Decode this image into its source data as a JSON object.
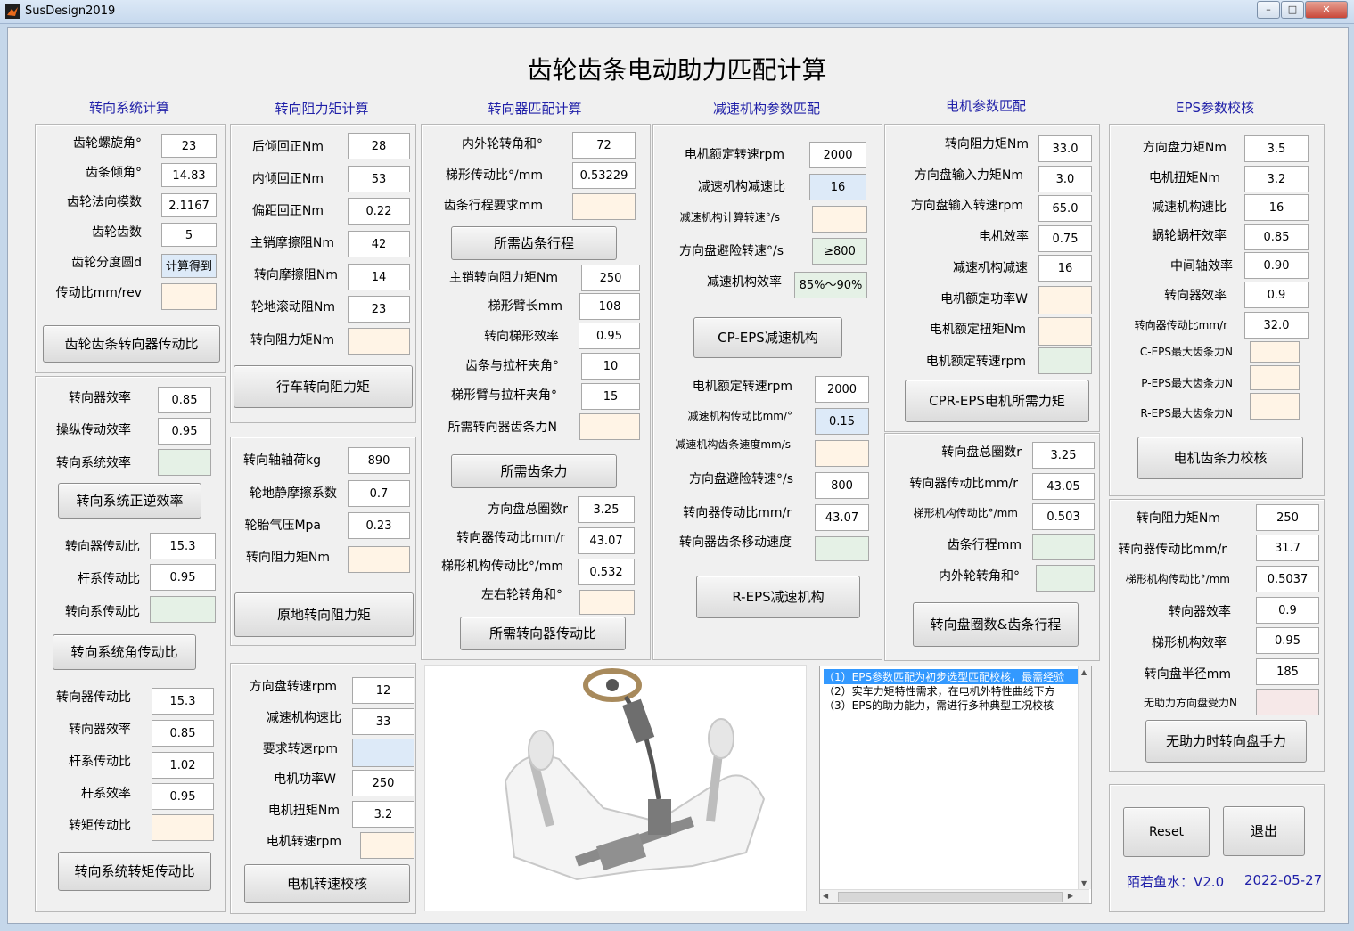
{
  "window": {
    "title": "SusDesign2019"
  },
  "main_title": "齿轮齿条电动助力匹配计算",
  "sections": {
    "s1": "转向系统计算",
    "s2": "转向阻力矩计算",
    "s3": "转向器匹配计算",
    "s4": "减速机构参数匹配",
    "s5": "电机参数匹配",
    "s6": "EPS参数校核"
  },
  "col1": {
    "p1": {
      "rows": [
        {
          "label": "齿轮螺旋角°",
          "value": "23"
        },
        {
          "label": "齿条倾角°",
          "value": "14.83"
        },
        {
          "label": "齿轮法向模数",
          "value": "2.1167"
        },
        {
          "label": "齿轮齿数",
          "value": "5"
        },
        {
          "label": "齿轮分度圆d",
          "value": "计算得到"
        },
        {
          "label": "传动比mm/rev",
          "value": ""
        }
      ],
      "button": "齿轮齿条转向器传动比"
    },
    "p2": {
      "rows": [
        {
          "label": "转向器效率",
          "value": "0.85"
        },
        {
          "label": "操纵传动效率",
          "value": "0.95"
        },
        {
          "label": "转向系统效率",
          "value": ""
        }
      ],
      "button": "转向系统正逆效率",
      "rows2": [
        {
          "label": "转向器传动比",
          "value": "15.3"
        },
        {
          "label": "杆系传动比",
          "value": "0.95"
        },
        {
          "label": "转向系传动比",
          "value": ""
        }
      ],
      "button2": "转向系统角传动比",
      "rows3": [
        {
          "label": "转向器传动比",
          "value": "15.3"
        },
        {
          "label": "转向器效率",
          "value": "0.85"
        },
        {
          "label": "杆系传动比",
          "value": "1.02"
        },
        {
          "label": "杆系效率",
          "value": "0.95"
        },
        {
          "label": "转矩传动比",
          "value": ""
        }
      ],
      "button3": "转向系统转矩传动比"
    }
  },
  "col2": {
    "p1": {
      "rows": [
        {
          "label": "后倾回正Nm",
          "value": "28"
        },
        {
          "label": "内倾回正Nm",
          "value": "53"
        },
        {
          "label": "偏距回正Nm",
          "value": "0.22"
        },
        {
          "label": "主销摩擦阻Nm",
          "value": "42"
        },
        {
          "label": "转向摩擦阻Nm",
          "value": "14"
        },
        {
          "label": "轮地滚动阻Nm",
          "value": "23"
        },
        {
          "label": "转向阻力矩Nm",
          "value": ""
        }
      ],
      "button": "行车转向阻力矩"
    },
    "p2": {
      "rows": [
        {
          "label": "转向轴轴荷kg",
          "value": "890"
        },
        {
          "label": "轮地静摩擦系数",
          "value": "0.7"
        },
        {
          "label": "轮胎气压Mpa",
          "value": "0.23"
        },
        {
          "label": "转向阻力矩Nm",
          "value": ""
        }
      ],
      "button": "原地转向阻力矩"
    },
    "p3": {
      "rows": [
        {
          "label": "方向盘转速rpm",
          "value": "12"
        },
        {
          "label": "减速机构速比",
          "value": "33"
        },
        {
          "label": "要求转速rpm",
          "value": ""
        },
        {
          "label": "电机功率W",
          "value": "250"
        },
        {
          "label": "电机扭矩Nm",
          "value": "3.2"
        },
        {
          "label": "电机转速rpm",
          "value": ""
        }
      ],
      "button": "电机转速校核"
    }
  },
  "col3": {
    "rows": [
      {
        "label": "内外轮转角和°",
        "value": "72"
      },
      {
        "label": "梯形传动比°/mm",
        "value": "0.53229"
      },
      {
        "label": "齿条行程要求mm",
        "value": ""
      }
    ],
    "button": "所需齿条行程",
    "rows2": [
      {
        "label": "主销转向阻力矩Nm",
        "value": "250"
      },
      {
        "label": "梯形臂长mm",
        "value": "108"
      },
      {
        "label": "转向梯形效率",
        "value": "0.95"
      },
      {
        "label": "齿条与拉杆夹角°",
        "value": "10"
      },
      {
        "label": "梯形臂与拉杆夹角°",
        "value": "15"
      },
      {
        "label": "所需转向器齿条力N",
        "value": ""
      }
    ],
    "button2": "所需齿条力",
    "rows3": [
      {
        "label": "方向盘总圈数r",
        "value": "3.25"
      },
      {
        "label": "转向器传动比mm/r",
        "value": "43.07"
      },
      {
        "label": "梯形机构传动比°/mm",
        "value": "0.532"
      },
      {
        "label": "左右轮转角和°",
        "value": ""
      }
    ],
    "button3": "所需转向器传动比"
  },
  "col4": {
    "rows": [
      {
        "label": "电机额定转速rpm",
        "value": "2000"
      },
      {
        "label": "减速机构减速比",
        "value": "16"
      },
      {
        "label": "减速机构计算转速°/s",
        "value": ""
      },
      {
        "label": "方向盘避险转速°/s",
        "value": "≥800"
      },
      {
        "label": "减速机构效率",
        "value": "85%～90%"
      }
    ],
    "button": "CP-EPS减速机构",
    "rows2": [
      {
        "label": "电机额定转速rpm",
        "value": "2000"
      },
      {
        "label": "减速机构传动比mm/°",
        "value": "0.15"
      },
      {
        "label": "减速机构齿条速度mm/s",
        "value": ""
      },
      {
        "label": "方向盘避险转速°/s",
        "value": "800"
      },
      {
        "label": "转向器传动比mm/r",
        "value": "43.07"
      },
      {
        "label": "转向器齿条移动速度mm/s",
        "value": ""
      }
    ],
    "button2": "R-EPS减速机构"
  },
  "col5": {
    "rows": [
      {
        "label": "转向阻力矩Nm",
        "value": "33.0"
      },
      {
        "label": "方向盘输入力矩Nm",
        "value": "3.0"
      },
      {
        "label": "方向盘输入转速rpm",
        "value": "65.0"
      },
      {
        "label": "电机效率",
        "value": "0.75"
      },
      {
        "label": "减速机构减速",
        "value": "16"
      },
      {
        "label": "电机额定功率W",
        "value": ""
      },
      {
        "label": "电机额定扭矩Nm",
        "value": ""
      },
      {
        "label": "电机额定转速rpm",
        "value": ""
      }
    ],
    "button": "CPR-EPS电机所需力矩",
    "rows2": [
      {
        "label": "转向盘总圈数r",
        "value": "3.25"
      },
      {
        "label": "转向器传动比mm/r",
        "value": "43.05"
      },
      {
        "label": "梯形机构传动比°/mm",
        "value": "0.503"
      },
      {
        "label": "齿条行程mm",
        "value": ""
      },
      {
        "label": "内外轮转角和°",
        "value": ""
      }
    ],
    "button2": "转向盘圈数&齿条行程"
  },
  "col6": {
    "rows": [
      {
        "label": "方向盘力矩Nm",
        "value": "3.5"
      },
      {
        "label": "电机扭矩Nm",
        "value": "3.2"
      },
      {
        "label": "减速机构速比",
        "value": "16"
      },
      {
        "label": "蜗轮蜗杆效率",
        "value": "0.85"
      },
      {
        "label": "中间轴效率",
        "value": "0.90"
      },
      {
        "label": "转向器效率",
        "value": "0.9"
      },
      {
        "label": "转向器传动比mm/r",
        "value": "32.0"
      },
      {
        "label": "C-EPS最大齿条力N",
        "value": ""
      },
      {
        "label": "P-EPS最大齿条力N",
        "value": ""
      },
      {
        "label": "R-EPS最大齿条力N",
        "value": ""
      }
    ],
    "button": "电机齿条力校核",
    "rows2": [
      {
        "label": "转向阻力矩Nm",
        "value": "250"
      },
      {
        "label": "转向器传动比mm/r",
        "value": "31.7"
      },
      {
        "label": "梯形机构传动比°/mm",
        "value": "0.5037"
      },
      {
        "label": "转向器效率",
        "value": "0.9"
      },
      {
        "label": "梯形机构效率",
        "value": "0.95"
      },
      {
        "label": "转向盘半径mm",
        "value": "185"
      },
      {
        "label": "无助力方向盘受力N",
        "value": ""
      }
    ],
    "button2": "无助力时转向盘手力"
  },
  "log": {
    "lines": [
      "（1）EPS参数匹配为初步选型匹配校核，最需经验",
      "（2）实车力矩特性需求，在电机外特性曲线下方",
      "（3）EPS的助力能力，需进行多种典型工况校核"
    ]
  },
  "footer": {
    "reset": "Reset",
    "exit": "退出",
    "author": "陌若鱼水：V2.0",
    "date": "2022-05-27"
  },
  "colors": {
    "section_title": "#1f1fa8",
    "highlight_orange": "#fff4e6",
    "highlight_green": "#e5f1e6",
    "highlight_blue": "#ddeaf8"
  },
  "image": {
    "icon": "eps-steering-system-image"
  }
}
